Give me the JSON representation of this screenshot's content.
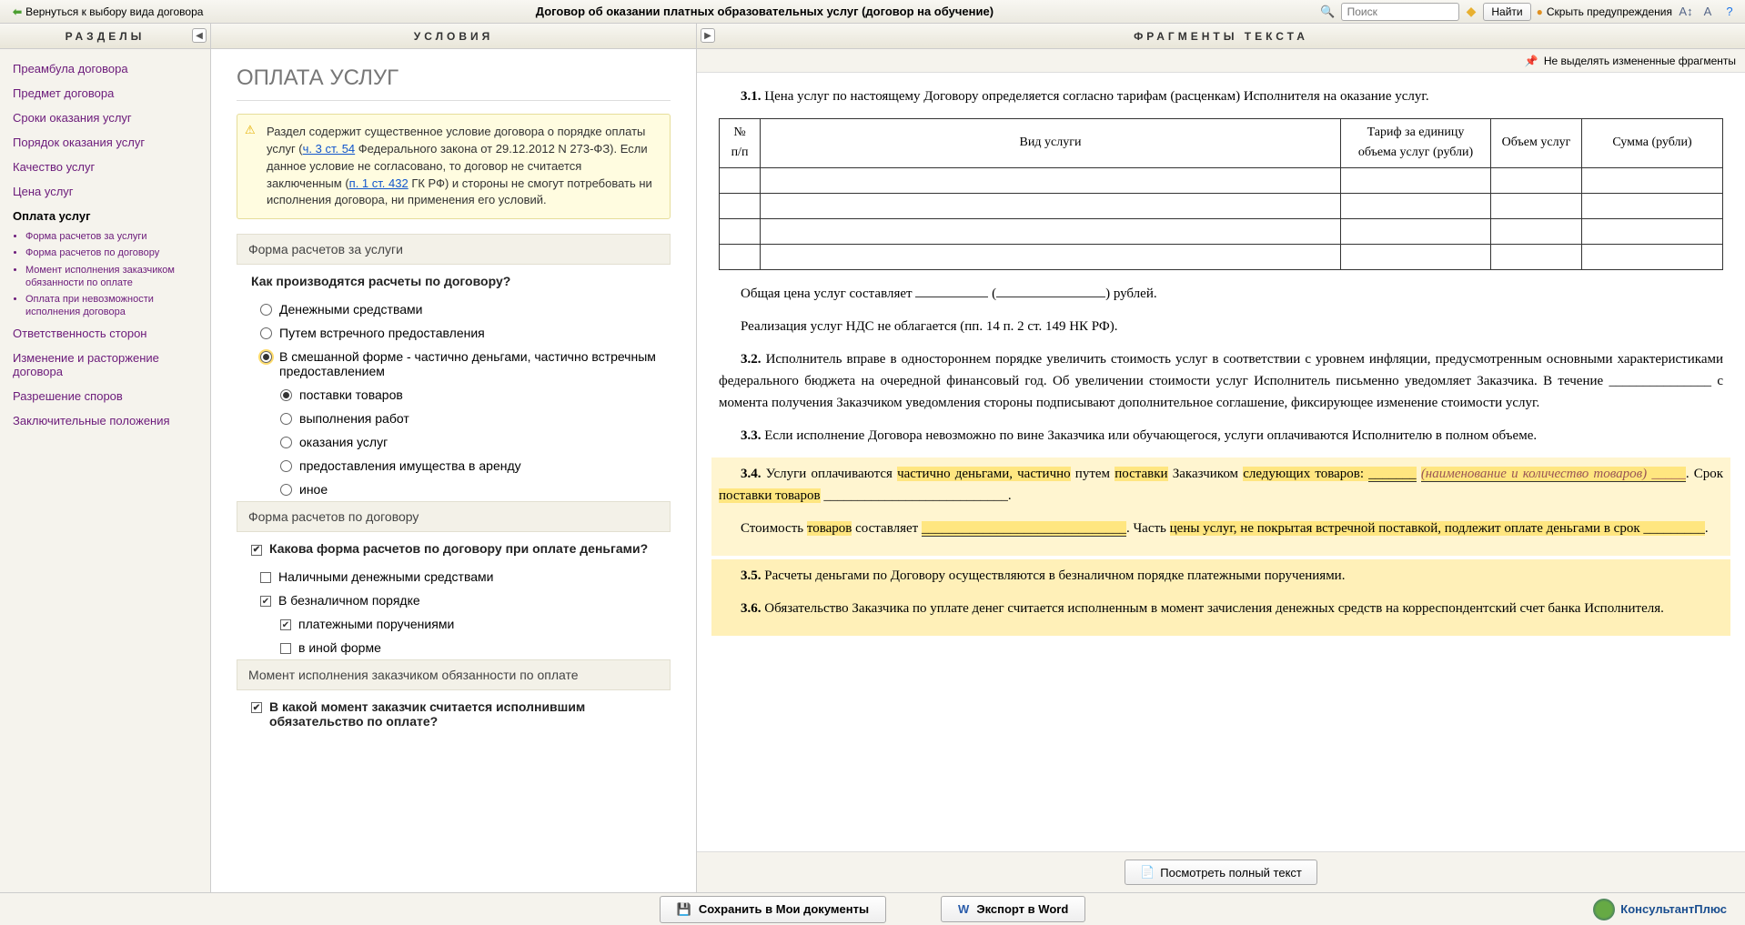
{
  "topbar": {
    "back_label": "Вернуться к выбору вида договора",
    "title": "Договор об оказании платных образовательных услуг (договор на обучение)",
    "search_placeholder": "Поиск",
    "find_label": "Найти",
    "hide_warnings_label": "Скрыть предупреждения"
  },
  "left": {
    "header": "РАЗДЕЛЫ",
    "items": [
      {
        "label": "Преамбула договора",
        "active": false
      },
      {
        "label": "Предмет договора",
        "active": false
      },
      {
        "label": "Сроки оказания услуг",
        "active": false
      },
      {
        "label": "Порядок оказания услуг",
        "active": false
      },
      {
        "label": "Качество услуг",
        "active": false
      },
      {
        "label": "Цена услуг",
        "active": false
      },
      {
        "label": "Оплата услуг",
        "active": true,
        "subs": [
          "Форма расчетов за услуги",
          "Форма расчетов по договору",
          "Момент исполнения заказчиком обязанности по оплате",
          "Оплата при невозможности исполнения договора"
        ]
      },
      {
        "label": "Ответственность сторон",
        "active": false
      },
      {
        "label": "Изменение и расторжение договора",
        "active": false
      },
      {
        "label": "Разрешение споров",
        "active": false
      },
      {
        "label": "Заключительные положения",
        "active": false
      }
    ]
  },
  "mid": {
    "header": "УСЛОВИЯ",
    "h1": "ОПЛАТА УСЛУГ",
    "warning_pre": "Раздел содержит существенное условие договора о порядке оплаты услуг (",
    "warning_link1": "ч. 3 ст. 54",
    "warning_mid1": " Федерального закона от 29.12.2012 N 273-ФЗ). Если данное условие не согласовано, то договор не считается заключенным (",
    "warning_link2": "п. 1 ст. 432",
    "warning_mid2": " ГК РФ) и стороны не смогут потребовать ни исполнения договора, ни применения его условий.",
    "section1": "Форма расчетов за услуги",
    "q1": "Как производятся расчеты по договору?",
    "q1_opts": [
      "Денежными средствами",
      "Путем встречного предоставления",
      "В смешанной форме - частично деньгами, частично встречным предоставлением"
    ],
    "q1_sub_opts": [
      "поставки товаров",
      "выполнения работ",
      "оказания услуг",
      "предоставления имущества в аренду",
      "иное"
    ],
    "section2": "Форма расчетов по договору",
    "q2": "Какова форма расчетов по договору при оплате деньгами?",
    "q2_opts": [
      "Наличными денежными средствами",
      "В безналичном порядке"
    ],
    "q2_sub_opts": [
      "платежными поручениями",
      "в иной форме"
    ],
    "section3": "Момент исполнения заказчиком обязанности по оплате",
    "q3": "В какой момент заказчик считается исполнившим обязательство по оплате?"
  },
  "right": {
    "header": "ФРАГМЕНТЫ ТЕКСТА",
    "toolbar_label": "Не выделять измененные фрагменты",
    "table_headers": [
      "№ п/п",
      "Вид услуги",
      "Тариф за единицу объема услуг (рубли)",
      "Объем услуг",
      "Сумма (рубли)"
    ],
    "c31_num": "3.1.",
    "c31_text": " Цена услуг по настоящему Договору определяется согласно тарифам (расценкам) Исполнителя на оказание услуг.",
    "sum_pre": "Общая цена услуг составляет ",
    "sum_post": " рублей.",
    "nds": "Реализация услуг НДС не облагается (пп. 14 п. 2 ст. 149 НК РФ).",
    "c32_num": "3.2.",
    "c32_text": " Исполнитель вправе в одностороннем порядке увеличить стоимость услуг в соответствии с уровнем инфляции, предусмотренным основными характеристиками федерального бюджета на очередной финансовый год. Об увеличении стоимости услуг Исполнитель письменно уведомляет Заказчика. В течение _______________ с момента получения Заказчиком уведомления стороны подписывают дополнительное соглашение, фиксирующее изменение стоимости услуг.",
    "c33_num": "3.3.",
    "c33_text": " Если исполнение Договора невозможно по вине Заказчика или обучающегося, услуги оплачиваются Исполнителю в полном объеме.",
    "c34_num": "3.4.",
    "c34_t1": " Услуги оплачиваются ",
    "c34_h1": "частично деньгами, частично",
    "c34_t2": " путем ",
    "c34_h2": "поставки",
    "c34_t3": " Заказчиком ",
    "c34_h3": "следующих товаров: ",
    "c34_blank1": "_______",
    "c34_placeholder": "(наименование и количество товаров)",
    "c34_blank1b": " _____",
    "c34_t4": ". Срок ",
    "c34_h4": "поставки товаров",
    "c34_t5": " ___________________________.",
    "c34b_t1": "Стоимость ",
    "c34b_h1": "товаров",
    "c34b_t2": " составляет ",
    "c34b_blank": " ______________________________",
    "c34b_t3": ". Часть ",
    "c34b_h2": "цены услуг, не покрытая встречной поставкой, подлежит оплате деньгами в срок _________",
    "c34b_t4": ".",
    "c35_num": "3.5.",
    "c35_text": " Расчеты деньгами по Договору осуществляются в безналичном порядке платежными поручениями.",
    "c36_num": "3.6.",
    "c36_text": " Обязательство Заказчика по уплате денег считается исполненным в момент зачисления денежных средств на корреспондентский счет банка Исполнителя.",
    "full_text_btn": "Посмотреть полный текст"
  },
  "bottom": {
    "save_label": "Сохранить в Мои документы",
    "export_label": "Экспорт в Word",
    "brand": "КонсультантПлюс"
  }
}
